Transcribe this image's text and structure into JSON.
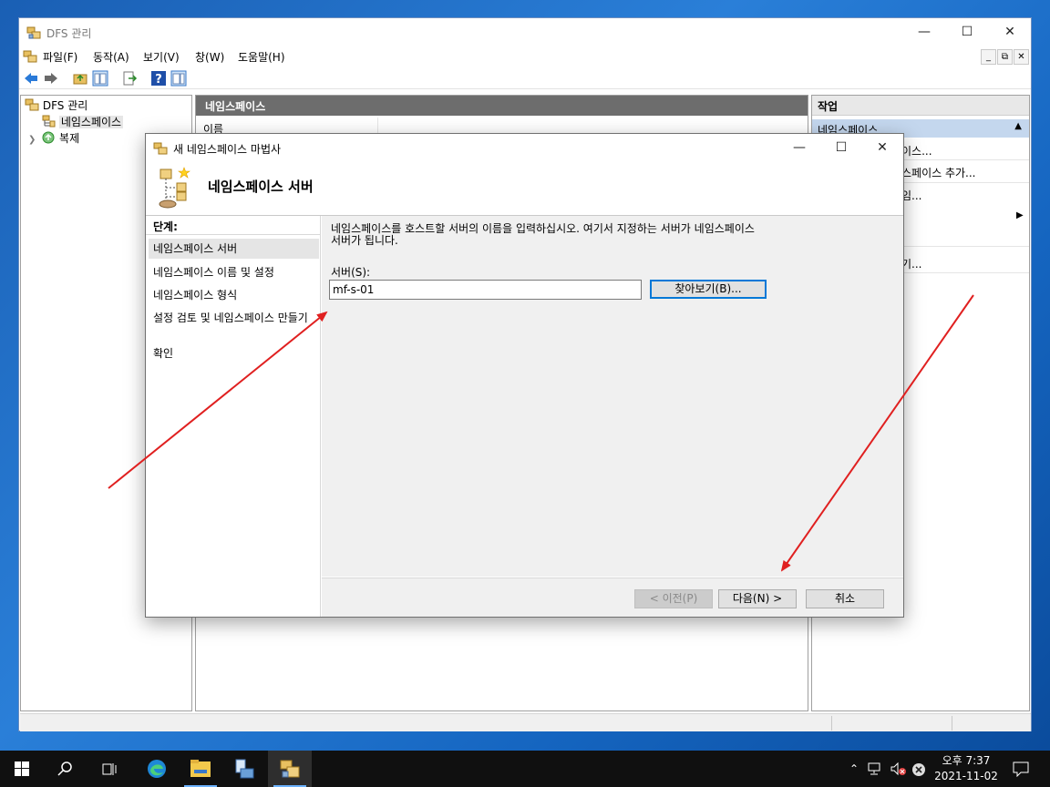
{
  "desktop": {
    "taskbar": {
      "clock_time": "오후 7:37",
      "clock_date": "2021-11-02"
    }
  },
  "mmc": {
    "title": "DFS 관리",
    "menu": [
      "파일(F)",
      "동작(A)",
      "보기(V)",
      "창(W)",
      "도움말(H)"
    ],
    "tree": {
      "root": "DFS 관리",
      "namespaces": "네임스페이스",
      "replication": "복제"
    },
    "center": {
      "header": "네임스페이스",
      "column_name": "이름"
    },
    "actions": {
      "header": "작업",
      "section": "네임스페이스",
      "items": [
        "이스...",
        "스페이스 추가...",
        "임...",
        "기..."
      ]
    }
  },
  "wizard": {
    "title": "새 네임스페이스 마법사",
    "heading": "네임스페이스 서버",
    "steps_title": "단계:",
    "steps": [
      "네임스페이스 서버",
      "네임스페이스 이름 및 설정",
      "네임스페이스 형식",
      "설정 검토 및 네임스페이스 만들기",
      "확인"
    ],
    "description": "네임스페이스를 호스트할 서버의 이름을 입력하십시오. 여기서 지정하는 서버가 네임스페이스 서버가 됩니다.",
    "server_label": "서버(S):",
    "server_value": "mf-s-01",
    "browse_label": "찾아보기(B)...",
    "prev_label": "< 이전(P)",
    "next_label": "다음(N) >",
    "cancel_label": "취소"
  },
  "colors": {
    "arrow": "#e02020",
    "selection": "#0078d7",
    "header_dark": "#6d6d6d",
    "actions_section": "#c4d7ee"
  }
}
